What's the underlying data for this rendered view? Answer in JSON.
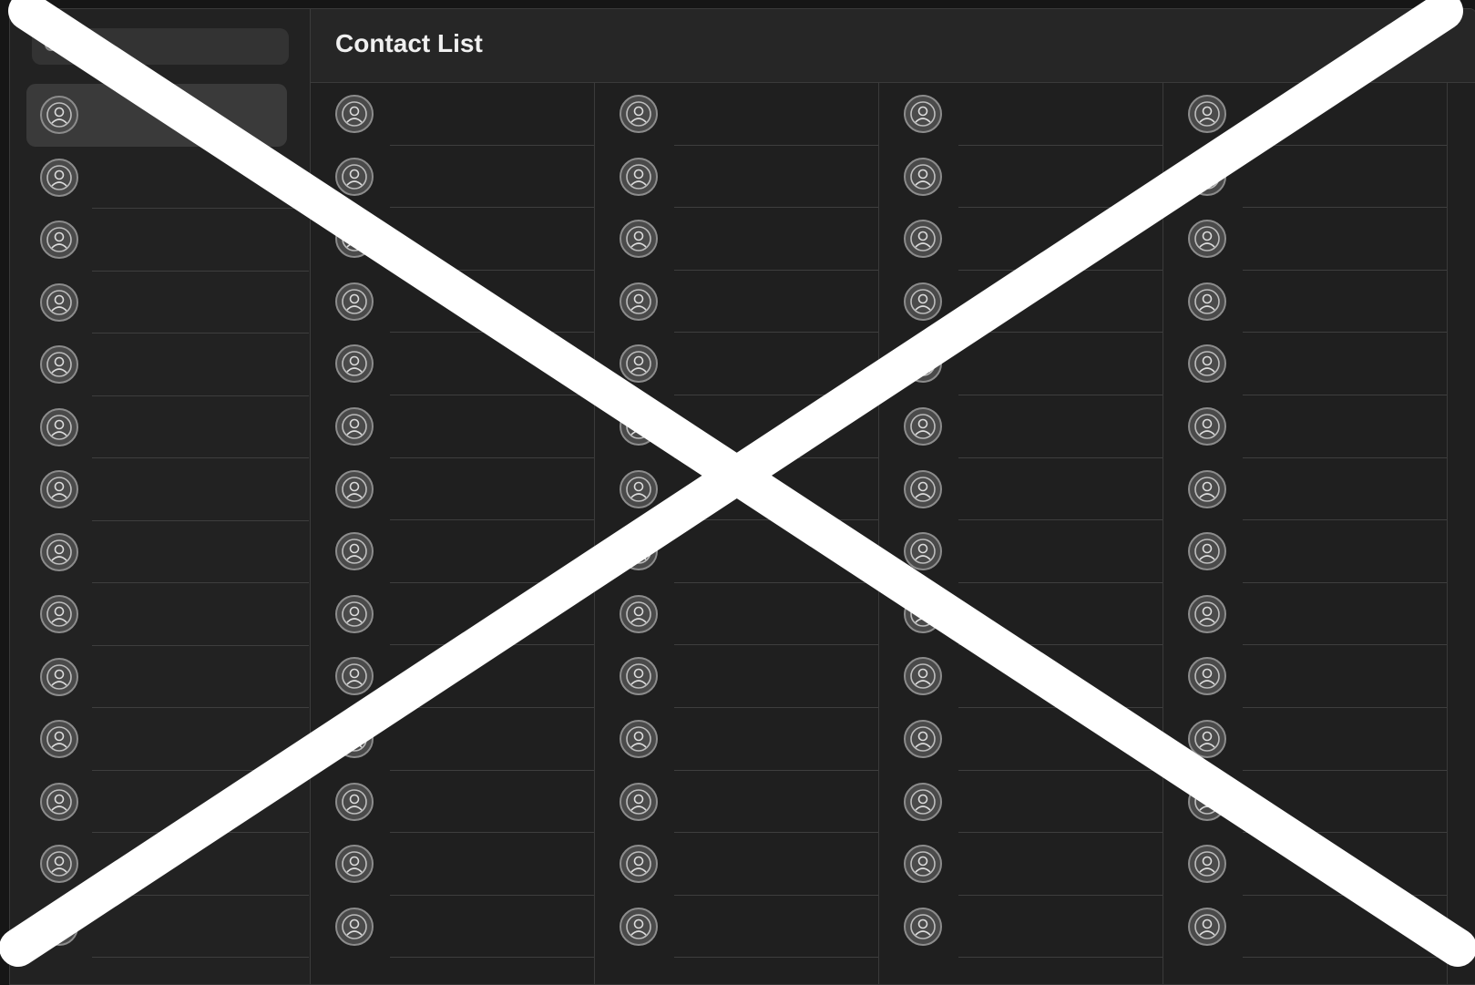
{
  "app": {
    "title": "Contact List",
    "search_placeholder": ""
  },
  "sidebar": {
    "contacts": [
      {
        "name": "",
        "phone": "",
        "selected": true
      },
      {
        "name": "",
        "phone": ""
      },
      {
        "name": "",
        "phone": ""
      },
      {
        "name": "",
        "phone": ""
      },
      {
        "name": "",
        "phone": ""
      },
      {
        "name": "",
        "phone": ""
      },
      {
        "name": "",
        "phone": ""
      },
      {
        "name": "",
        "phone": ""
      },
      {
        "name": "",
        "phone": ""
      },
      {
        "name": "",
        "phone": ""
      },
      {
        "name": "",
        "phone": ""
      },
      {
        "name": "",
        "phone": ""
      },
      {
        "name": "",
        "phone": ""
      },
      {
        "name": "",
        "phone": ""
      }
    ]
  },
  "grid": {
    "columns": [
      {
        "contacts": [
          {
            "name": "",
            "phone": ""
          },
          {
            "name": "",
            "phone": ""
          },
          {
            "name": "",
            "phone": ""
          },
          {
            "name": "",
            "phone": ""
          },
          {
            "name": "",
            "phone": ""
          },
          {
            "name": "",
            "phone": ""
          },
          {
            "name": "",
            "phone": ""
          },
          {
            "name": "",
            "phone": ""
          },
          {
            "name": "",
            "phone": ""
          },
          {
            "name": "",
            "phone": ""
          },
          {
            "name": "",
            "phone": ""
          },
          {
            "name": "",
            "phone": ""
          },
          {
            "name": "",
            "phone": ""
          },
          {
            "name": "",
            "phone": ""
          }
        ]
      },
      {
        "contacts": [
          {
            "name": "",
            "phone": ""
          },
          {
            "name": "",
            "phone": ""
          },
          {
            "name": "",
            "phone": ""
          },
          {
            "name": "",
            "phone": ""
          },
          {
            "name": "",
            "phone": ""
          },
          {
            "name": "",
            "phone": ""
          },
          {
            "name": "",
            "phone": ""
          },
          {
            "name": "",
            "phone": ""
          },
          {
            "name": "",
            "phone": ""
          },
          {
            "name": "",
            "phone": ""
          },
          {
            "name": "",
            "phone": ""
          },
          {
            "name": "",
            "phone": ""
          },
          {
            "name": "",
            "phone": ""
          },
          {
            "name": "",
            "phone": ""
          }
        ]
      },
      {
        "contacts": [
          {
            "name": "",
            "phone": ""
          },
          {
            "name": "",
            "phone": ""
          },
          {
            "name": "",
            "phone": ""
          },
          {
            "name": "",
            "phone": ""
          },
          {
            "name": "",
            "phone": ""
          },
          {
            "name": "",
            "phone": ""
          },
          {
            "name": "",
            "phone": ""
          },
          {
            "name": "",
            "phone": ""
          },
          {
            "name": "",
            "phone": ""
          },
          {
            "name": "",
            "phone": ""
          },
          {
            "name": "",
            "phone": ""
          },
          {
            "name": "",
            "phone": ""
          },
          {
            "name": "",
            "phone": ""
          },
          {
            "name": "",
            "phone": ""
          }
        ]
      },
      {
        "contacts": [
          {
            "name": "",
            "phone": ""
          },
          {
            "name": "",
            "phone": ""
          },
          {
            "name": "",
            "phone": ""
          },
          {
            "name": "",
            "phone": ""
          },
          {
            "name": "",
            "phone": ""
          },
          {
            "name": "",
            "phone": ""
          },
          {
            "name": "",
            "phone": ""
          },
          {
            "name": "",
            "phone": ""
          },
          {
            "name": "",
            "phone": ""
          },
          {
            "name": "",
            "phone": ""
          },
          {
            "name": "",
            "phone": ""
          },
          {
            "name": "",
            "phone": ""
          },
          {
            "name": "",
            "phone": ""
          },
          {
            "name": "",
            "phone": ""
          }
        ]
      }
    ]
  },
  "icons": {
    "search": "search-icon",
    "avatar": "person-avatar-icon"
  },
  "colors": {
    "background": "#1f1f1f",
    "selected_row": "#3a3a3a",
    "overlay_cross": "#ffffff"
  }
}
